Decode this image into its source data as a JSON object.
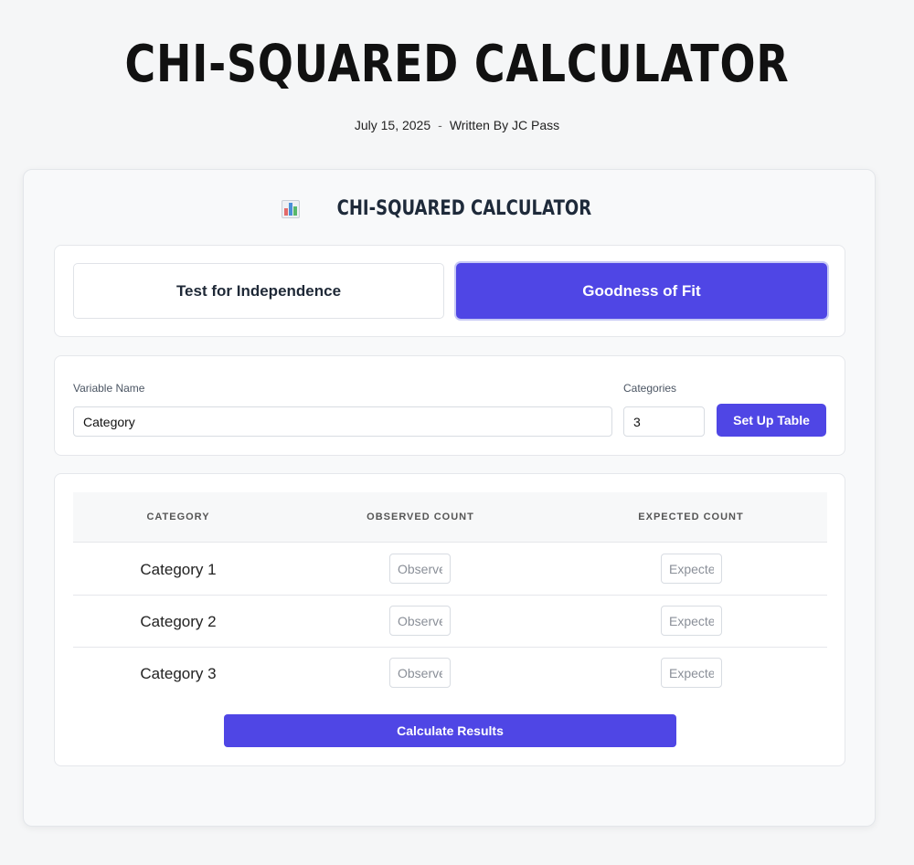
{
  "page": {
    "title": "CHI-SQUARED CALCULATOR",
    "date": "July 15, 2025",
    "separator": "-",
    "author_line": "Written By JC Pass"
  },
  "card": {
    "icon": "bar-chart-icon",
    "title": "CHI-SQUARED CALCULATOR"
  },
  "tabs": {
    "independence": "Test for Independence",
    "goodness": "Goodness of Fit",
    "active": "goodness"
  },
  "setup": {
    "variable_label": "Variable Name",
    "variable_value": "Category",
    "categories_label": "Categories",
    "categories_value": "3",
    "button": "Set Up Table"
  },
  "table": {
    "headers": [
      "CATEGORY",
      "OBSERVED COUNT",
      "EXPECTED COUNT"
    ],
    "rows": [
      {
        "label": "Category 1",
        "observed_placeholder": "Observed",
        "expected_placeholder": "Expected"
      },
      {
        "label": "Category 2",
        "observed_placeholder": "Observed",
        "expected_placeholder": "Expected"
      },
      {
        "label": "Category 3",
        "observed_placeholder": "Observed",
        "expected_placeholder": "Expected"
      }
    ],
    "calculate_button": "Calculate Results"
  },
  "colors": {
    "accent": "#4f46e5",
    "background": "#f5f6f7"
  }
}
